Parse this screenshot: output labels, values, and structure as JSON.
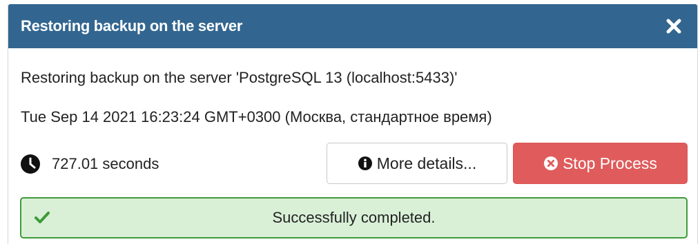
{
  "dialog": {
    "title": "Restoring backup on the server",
    "description": "Restoring backup on the server 'PostgreSQL 13 (localhost:5433)'",
    "timestamp": "Tue Sep 14 2021 16:23:24 GMT+0300 (Москва, стандартное время)",
    "elapsed": "727.01 seconds",
    "more_details_label": "More details...",
    "stop_label": "Stop Process",
    "status_message": "Successfully completed."
  },
  "icons": {
    "close": "close-icon",
    "clock": "clock-icon",
    "info": "info-circle-icon",
    "stop": "times-circle-icon",
    "check": "check-icon"
  },
  "colors": {
    "header_bg": "#326690",
    "stop_button": "#e05c5c",
    "success_bg": "#d9f0d7",
    "success_border": "#3f9a3a"
  }
}
